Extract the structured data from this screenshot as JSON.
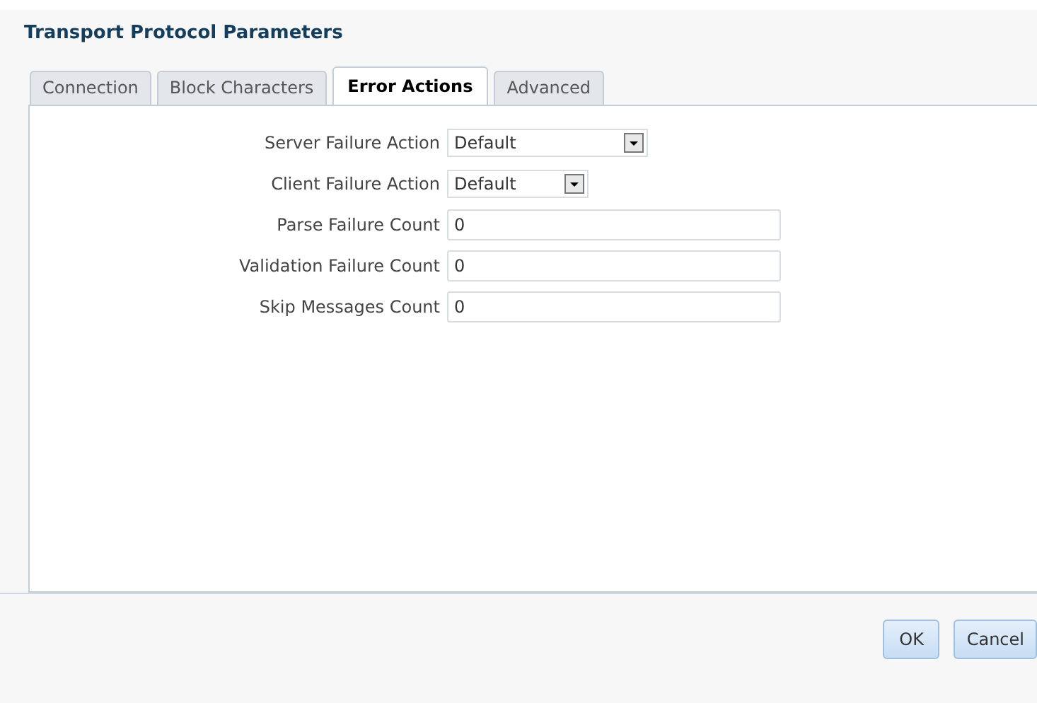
{
  "dialog": {
    "title": "Transport Protocol Parameters"
  },
  "tabs": [
    {
      "label": "Connection",
      "selected": false
    },
    {
      "label": "Block Characters",
      "selected": false
    },
    {
      "label": "Error Actions",
      "selected": true
    },
    {
      "label": "Advanced",
      "selected": false
    }
  ],
  "fields": [
    {
      "kind": "wide-select",
      "label": "Server Failure Action",
      "value": "Default"
    },
    {
      "kind": "select",
      "label": "Client Failure Action",
      "value": "Default"
    },
    {
      "kind": "text",
      "label": "Parse Failure Count",
      "value": "0"
    },
    {
      "kind": "text",
      "label": "Validation Failure Count",
      "value": "0"
    },
    {
      "kind": "text",
      "label": "Skip Messages Count",
      "value": "0"
    }
  ],
  "buttons": [
    "OK",
    "Cancel"
  ]
}
